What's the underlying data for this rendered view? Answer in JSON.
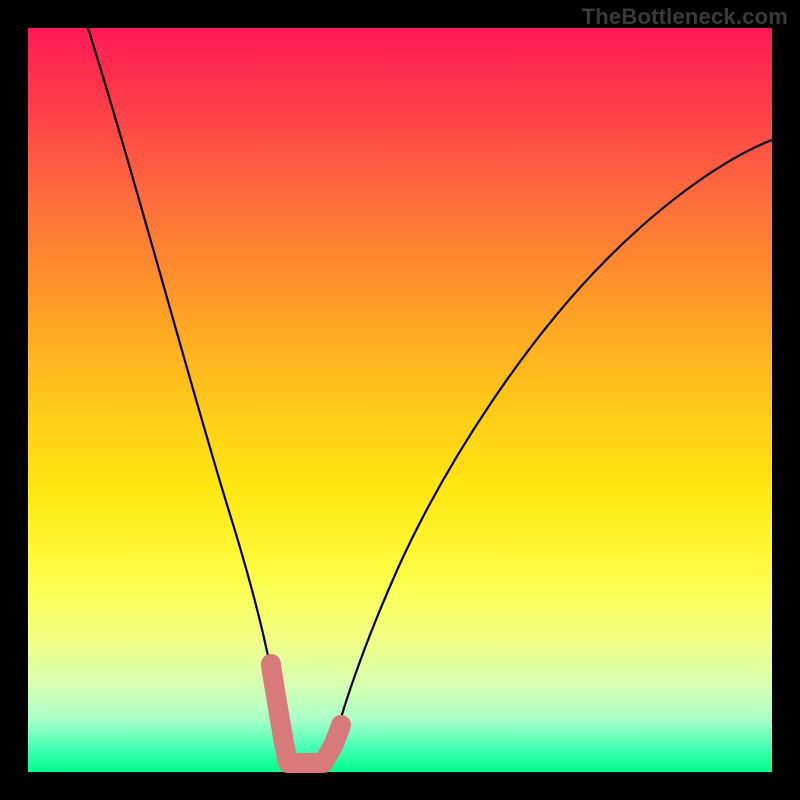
{
  "watermark": "TheBottleneck.com",
  "chart_data": {
    "type": "line",
    "title": "",
    "xlabel": "",
    "ylabel": "",
    "xlim": [
      0,
      100
    ],
    "ylim": [
      0,
      100
    ],
    "grid": false,
    "legend": false,
    "series": [
      {
        "name": "left-curve",
        "x": [
          8,
          12,
          16,
          20,
          24,
          27,
          29,
          31,
          32.5,
          33.5,
          34.2
        ],
        "values": [
          100,
          85,
          69,
          52,
          36,
          23,
          15,
          9,
          5,
          3,
          2
        ]
      },
      {
        "name": "right-curve",
        "x": [
          40,
          42,
          45,
          49,
          54,
          60,
          67,
          75,
          84,
          92,
          100
        ],
        "values": [
          2,
          5,
          11,
          20,
          31,
          43,
          54,
          64,
          73,
          80,
          85
        ]
      },
      {
        "name": "highlight-segment",
        "x": [
          32,
          33,
          34,
          36,
          38,
          40,
          41
        ],
        "values": [
          14,
          8,
          3,
          2,
          2,
          3,
          6
        ]
      }
    ],
    "annotations": []
  }
}
